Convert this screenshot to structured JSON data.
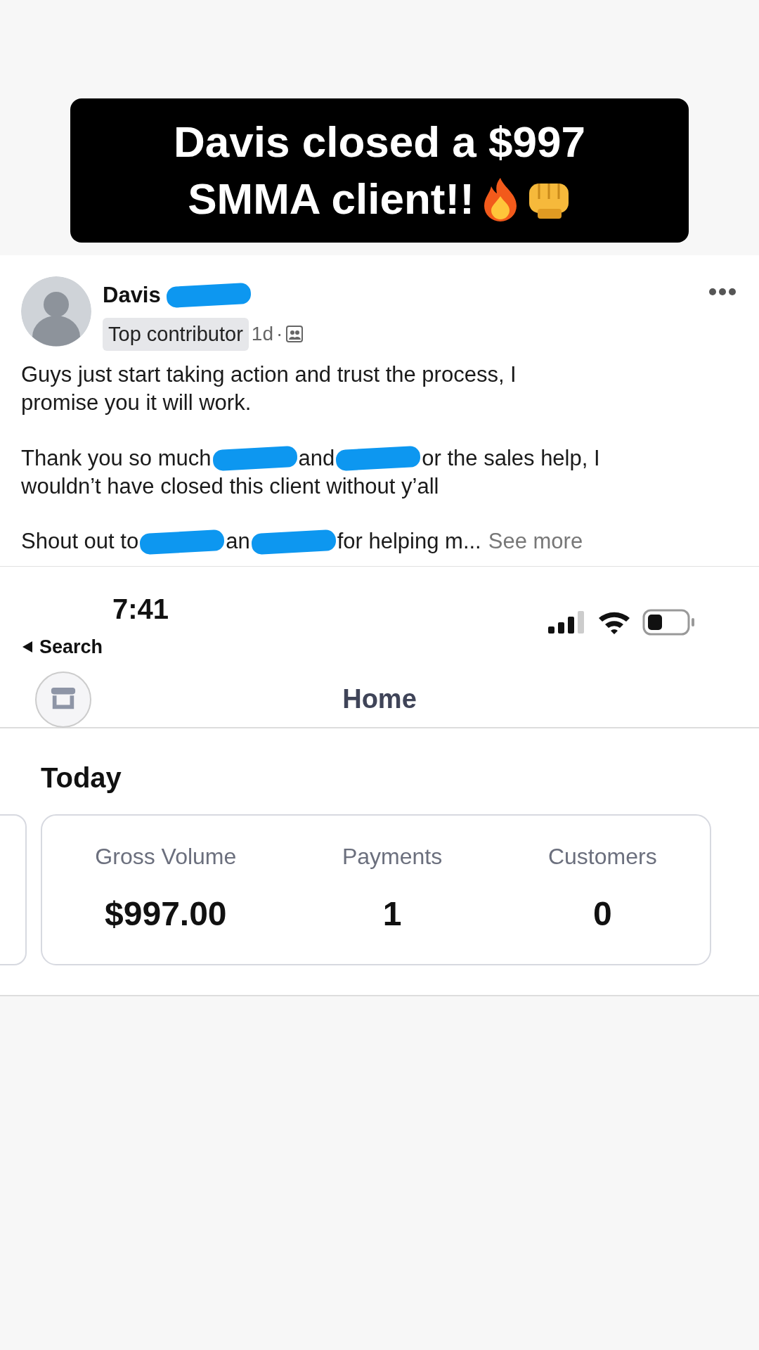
{
  "banner": {
    "lines": [
      "Davis closed a $997",
      "SMMA client!!"
    ]
  },
  "post": {
    "author": "Davis",
    "badge": "Top contributor",
    "time": "1d",
    "separator": "·",
    "paragraphs": [
      [
        [
          {
            "kind": "text",
            "text": "Guys just start taking action and trust the process, I"
          }
        ],
        [
          {
            "kind": "text",
            "text": "promise you it will work."
          }
        ]
      ],
      [
        [
          {
            "kind": "text",
            "text": "Thank you so much"
          },
          {
            "kind": "redacted"
          },
          {
            "kind": "text",
            "text": "and"
          },
          {
            "kind": "redacted"
          },
          {
            "kind": "text",
            "text": "or the sales help, I"
          }
        ],
        [
          {
            "kind": "text",
            "text": "wouldn’t have closed this client without y’all"
          }
        ]
      ],
      [
        [
          {
            "kind": "text",
            "text": "Shout out to"
          },
          {
            "kind": "redacted"
          },
          {
            "kind": "text",
            "text": "an"
          },
          {
            "kind": "redacted"
          },
          {
            "kind": "text",
            "text": "for helping m..."
          },
          {
            "kind": "link",
            "text": "See more"
          }
        ]
      ]
    ]
  },
  "status_bar": {
    "time": "7:41",
    "back": "Search"
  },
  "app": {
    "title": "Home",
    "section": "Today",
    "metrics": [
      {
        "label": "Gross Volume",
        "value": "$997.00"
      },
      {
        "label": "Payments",
        "value": "1"
      },
      {
        "label": "Customers",
        "value": "0"
      }
    ]
  }
}
